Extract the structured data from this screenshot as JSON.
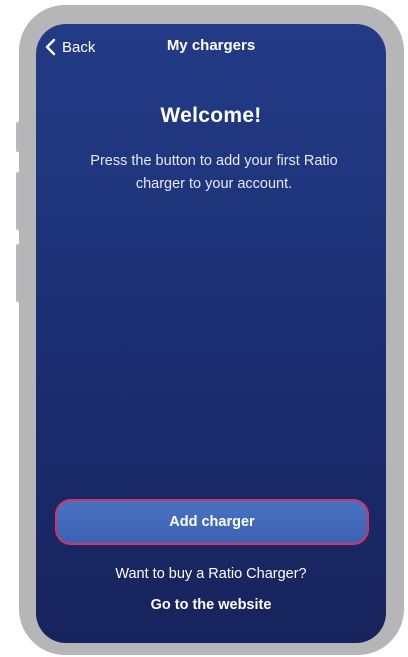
{
  "header": {
    "back_label": "Back",
    "title": "My chargers",
    "back_icon": "chevron-left-icon"
  },
  "main": {
    "heading": "Welcome!",
    "description": "Press the button to add your first Ratio charger to your account."
  },
  "actions": {
    "add_charger_label": "Add charger",
    "buy_prompt": "Want to buy a Ratio Charger?",
    "website_link_label": "Go to the website"
  },
  "colors": {
    "background_top": "#233b87",
    "background_bottom": "#17235c",
    "button_fill": "#3b61b2",
    "button_border": "#d4336a",
    "device_frame": "#b6b6b9"
  }
}
